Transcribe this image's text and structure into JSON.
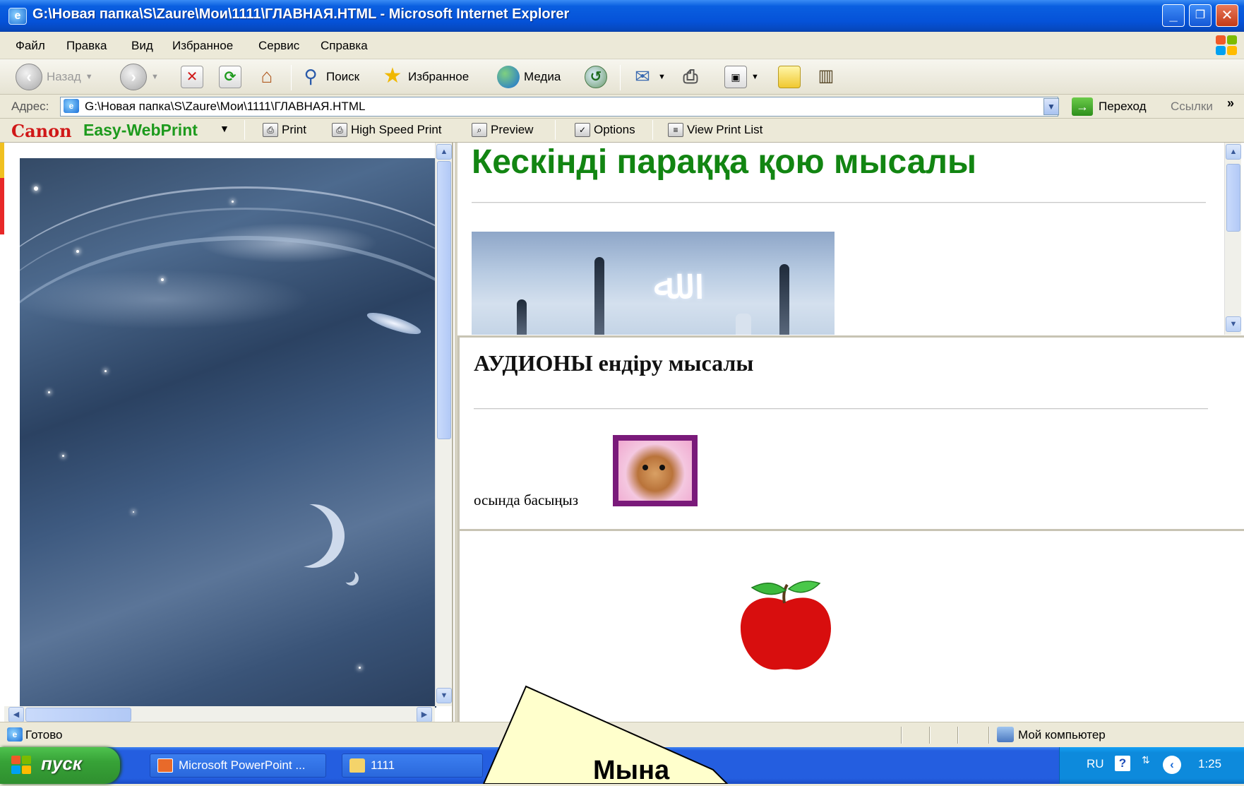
{
  "window": {
    "title": "G:\\Новая папка\\S\\Zaure\\Мои\\1111\\ГЛАВНАЯ.HTML - Microsoft Internet Explorer"
  },
  "menu": [
    "Файл",
    "Правка",
    "Вид",
    "Избранное",
    "Сервис",
    "Справка"
  ],
  "toolbar": {
    "back": "Назад",
    "search": "Поиск",
    "favorites": "Избранное",
    "media": "Медиа"
  },
  "address": {
    "label": "Адрес:",
    "value": "G:\\Новая папка\\S\\Zaure\\Мои\\1111\\ГЛАВНАЯ.HTML",
    "go": "Переход",
    "links": "Ссылки",
    "more": "»"
  },
  "canon": {
    "brand": "Canon",
    "product": "Easy-WebPrint",
    "print": "Print",
    "high_speed_print": "High Speed Print",
    "preview": "Preview",
    "options": "Options",
    "view_print_list": "View Print List"
  },
  "page": {
    "top_heading": "Кескінді параққа қою мысалы",
    "audio_heading": "АУДИОНЫ ендіру мысалы",
    "click_here": "осында басыңыз"
  },
  "callout": {
    "text": "Мына"
  },
  "status": {
    "ready": "Готово",
    "zone": "Мой компьютер"
  },
  "taskbar": {
    "start": "пуск",
    "items": [
      "Microsoft PowerPoint ...",
      "1111"
    ],
    "lang": "RU",
    "time": "1:25"
  },
  "colors": {
    "heading_green": "#128512",
    "canon_red": "#d01818",
    "canon_green": "#1d9a1d",
    "title_bar_blue": "#0552d8"
  }
}
